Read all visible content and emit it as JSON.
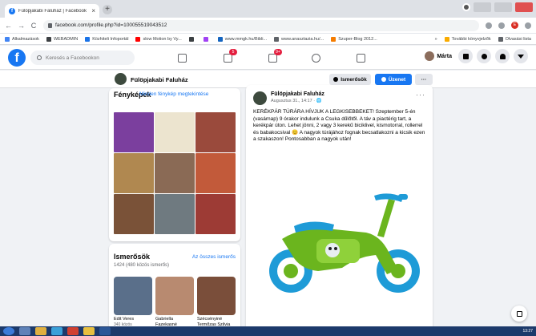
{
  "browser": {
    "tab_title": "Fülöpjakabi Faluház | Facebook",
    "tab_close": "×",
    "new_tab": "+",
    "url": "facebook.com/profile.php?id=100055519043512",
    "back": "←",
    "forward": "→",
    "reload": "C",
    "bookmarks": [
      {
        "label": "Alkalmazások",
        "color": "#4285f4"
      },
      {
        "label": "WEBADMIN",
        "color": "#3c4043"
      },
      {
        "label": "Közhiteli Infoportál",
        "color": "#1a73e8"
      },
      {
        "label": "slow Motion by Vy...",
        "color": "#ff0000"
      },
      {
        "label": "",
        "color": "#3c4043"
      },
      {
        "label": "",
        "color": "#a142f4"
      },
      {
        "label": "www.mmgk.hu/Bibli...",
        "color": "#1565c0"
      },
      {
        "label": "www.anasztazia.hu/...",
        "color": "#5f6368"
      },
      {
        "label": "Szuper-Blog 2012...",
        "color": "#f57c00"
      }
    ],
    "bookmarks_right": [
      {
        "label": "»",
        "color": "#ffffff"
      },
      {
        "label": "További könyvjelzők",
        "color": "#f9ab00"
      },
      {
        "label": "Olvasási lista",
        "color": "#5f6368"
      }
    ]
  },
  "facebook": {
    "logo": "f",
    "search_placeholder": "Keresés a Facebookon",
    "nav": [
      {
        "name": "home",
        "badge": ""
      },
      {
        "name": "pages",
        "badge": "5"
      },
      {
        "name": "watch",
        "badge": "9+"
      },
      {
        "name": "groups",
        "badge": ""
      },
      {
        "name": "gaming",
        "badge": ""
      }
    ],
    "user_name": "Márta"
  },
  "page_header": {
    "name": "Fülöpjakabi Faluház",
    "friends_button": "Ismerősök",
    "message_button": "Üzenet",
    "more_button": "···"
  },
  "photos": {
    "title": "Fényképek",
    "see_all": "Minden fénykép megtekintése",
    "tiles": [
      "#7b3f9e",
      "#ece4cf",
      "#9a4a3c",
      "#b08850",
      "#8a6a55",
      "#c25a3a",
      "#7a5238",
      "#6f7a80",
      "#9d3b35"
    ]
  },
  "friends": {
    "title": "Ismerősök",
    "see_all": "Az összes ismerős",
    "count": "1424 (480 közös ismerős)",
    "list": [
      {
        "name": "Edit Veres",
        "sub": "340 közös",
        "color": "#5a6f8a"
      },
      {
        "name": "Gabriella Fazekasné",
        "sub": "",
        "color": "#b88a70"
      },
      {
        "name": "Szécsényiné Termőzas Szilvia",
        "sub": "",
        "color": "#7a4e3a"
      }
    ]
  },
  "post": {
    "author": "Fülöpjakabi Faluház",
    "time": "Augusztus 31., 14:17 · 🌐",
    "more": "···",
    "text": "KERÉKPÁR TÚRÁRA HÍVJUK A LEGKISEBBEKET! Szeptember 5-én (vasárnap) 9 órakor indulunk a Csuka dűlőtől. A táv a piactérig tart, a kerékpár úton. Lehet jönni, 2 vagy 3 kerekű biciklivel, kismotorral, rollerrel és babakocsival 😊 A nagyok túrájához fognak becsatlakozni a kicsik ezen a szakaszon! Pontosabban a nagyok után!"
  },
  "taskbar": {
    "time": "13:27"
  },
  "colors": {
    "fb_blue": "#1877f2",
    "badge_red": "#e41e3f",
    "bike_green": "#6bb51e",
    "bike_blue": "#1e9bd7"
  }
}
